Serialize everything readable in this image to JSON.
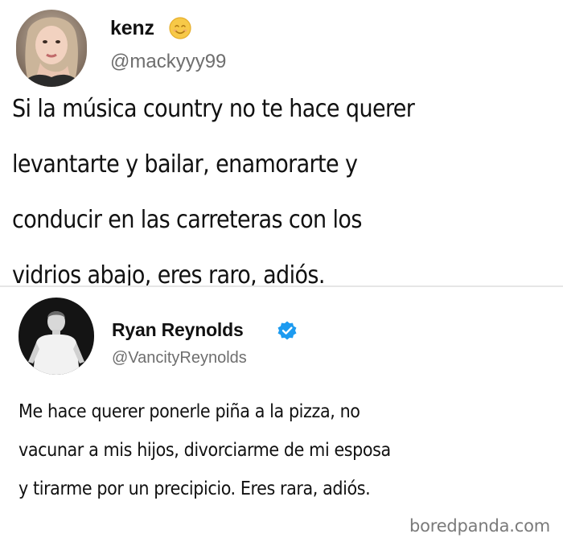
{
  "tweets": [
    {
      "author_name": "kenz",
      "author_handle": "@mackyyy99",
      "name_badge_icon": "smiling-face-emoji-icon",
      "body_lines": [
        "Si la música country no te hace querer",
        "levantarte y bailar, enamorarte y",
        "conducir en las carreteras con los",
        "vidrios abajo, eres raro, adiós."
      ]
    },
    {
      "author_name": "Ryan Reynolds",
      "author_handle": "@VancityReynolds",
      "name_badge_icon": "verified-badge-icon",
      "body_lines": [
        "Me hace querer ponerle piña a la pizza, no",
        "vacunar a mis hijos, divorciarme de mi esposa",
        "y tirarme por un precipicio. Eres rara, adiós."
      ]
    }
  ],
  "watermark": "boredpanda.com",
  "colors": {
    "verified_badge": "#1d9bf0",
    "handle_text": "#6e6e6e",
    "emoji_face": "#f7c948"
  }
}
